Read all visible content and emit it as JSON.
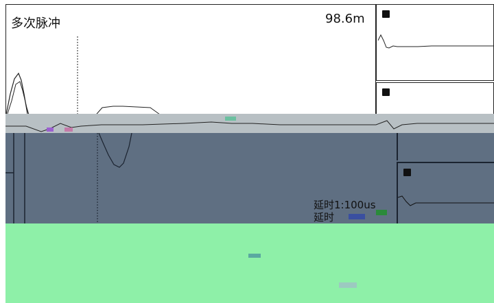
{
  "main": {
    "title": "多次脉冲",
    "distance": "98.6m"
  },
  "readouts": {
    "delay_1": "延时1:100us",
    "delay_2": "延时"
  },
  "colors": {
    "background": "#ffffff",
    "dark_panel": "#5f6f82",
    "green_panel": "#8ef0a8",
    "glitch_band": "#b8c0c4",
    "trace": "#222222"
  },
  "icons": {
    "channel_marker": "square-marker-icon",
    "cursor": "dashed-cursor-line"
  }
}
